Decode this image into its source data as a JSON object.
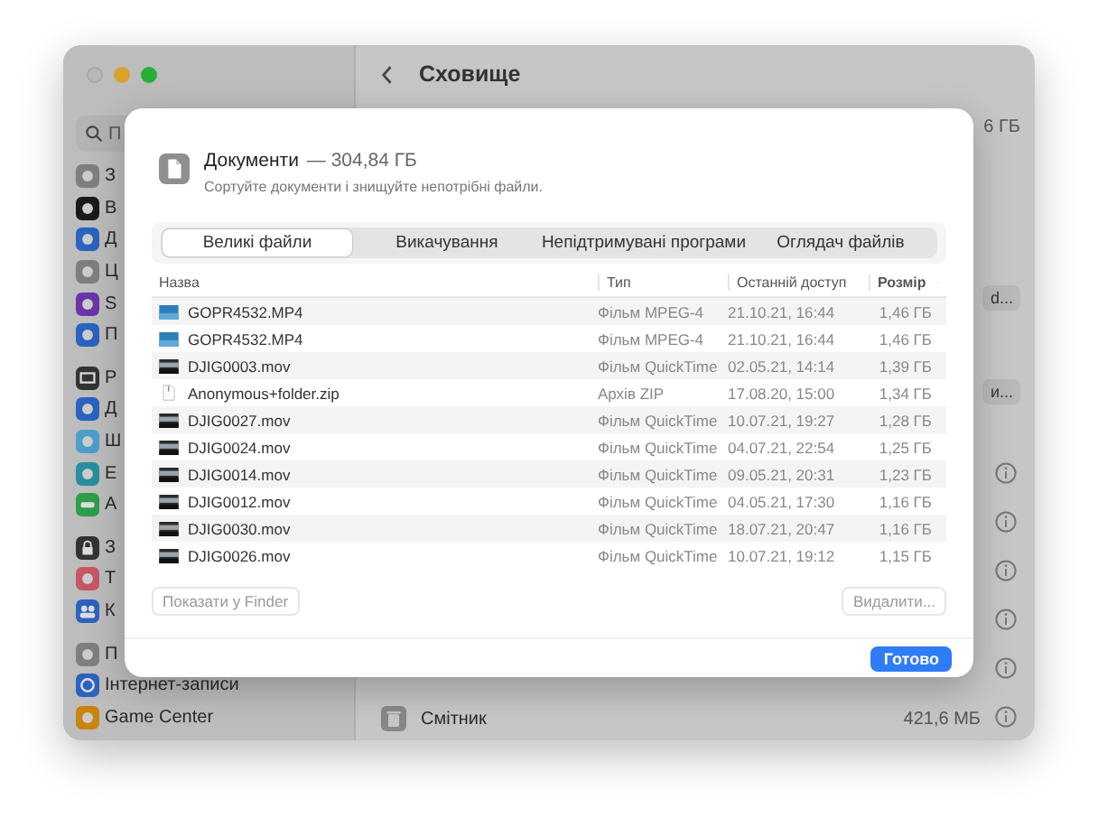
{
  "window": {
    "title": "Сховище",
    "search": {
      "placeholder": "П"
    },
    "sidebar": {
      "groups": [
        [
          {
            "label": "З"
          },
          {
            "label": "В"
          },
          {
            "label": "Д"
          },
          {
            "label": "Ц"
          },
          {
            "label": "S"
          },
          {
            "label": "П"
          }
        ],
        [
          {
            "label": "Р"
          },
          {
            "label": "Д"
          },
          {
            "label": "Ш"
          },
          {
            "label": "Е"
          },
          {
            "label": "А"
          }
        ],
        [
          {
            "label": "З"
          },
          {
            "label": "Т"
          },
          {
            "label": "К"
          }
        ],
        [
          {
            "label": "П"
          },
          {
            "label": "Інтернет-записи"
          },
          {
            "label": "Game Center"
          }
        ]
      ]
    },
    "total_fragment": "6 ГБ",
    "button_fragments": [
      "d...",
      "и..."
    ],
    "trash": {
      "label": "Смітник",
      "size": "421,6 МБ"
    }
  },
  "dialog": {
    "title": "Документи",
    "size": "— 304,84 ГБ",
    "subtitle": "Сортуйте документи і знищуйте непотрібні файли.",
    "tabs": [
      {
        "label": "Великі файли",
        "selected": true
      },
      {
        "label": "Викачування",
        "selected": false
      },
      {
        "label": "Непідтримувані програми",
        "selected": false
      },
      {
        "label": "Оглядач файлів",
        "selected": false
      }
    ],
    "table": {
      "columns": [
        {
          "label": "Назва",
          "sorted": false
        },
        {
          "label": "Тип",
          "sorted": false
        },
        {
          "label": "Останній доступ",
          "sorted": false
        },
        {
          "label": "Розмір",
          "sorted": true
        }
      ],
      "rows": [
        {
          "kind": "video",
          "name": "GOPR4532.MP4",
          "type": "Фільм MPEG-4",
          "accessed": "21.10.21, 16:44",
          "size": "1,46 ГБ"
        },
        {
          "kind": "video",
          "name": "GOPR4532.MP4",
          "type": "Фільм MPEG-4",
          "accessed": "21.10.21, 16:44",
          "size": "1,46 ГБ"
        },
        {
          "kind": "movie",
          "name": "DJIG0003.mov",
          "type": "Фільм QuickTime",
          "accessed": "02.05.21, 14:14",
          "size": "1,39 ГБ"
        },
        {
          "kind": "archive",
          "name": "Anonymous+folder.zip",
          "type": "Архів ZIP",
          "accessed": "17.08.20, 15:00",
          "size": "1,34 ГБ"
        },
        {
          "kind": "movie",
          "name": "DJIG0027.mov",
          "type": "Фільм QuickTime",
          "accessed": "10.07.21, 19:27",
          "size": "1,28 ГБ"
        },
        {
          "kind": "movie",
          "name": "DJIG0024.mov",
          "type": "Фільм QuickTime",
          "accessed": "04.07.21, 22:54",
          "size": "1,25 ГБ"
        },
        {
          "kind": "movie",
          "name": "DJIG0014.mov",
          "type": "Фільм QuickTime",
          "accessed": "09.05.21, 20:31",
          "size": "1,23 ГБ"
        },
        {
          "kind": "movie",
          "name": "DJIG0012.mov",
          "type": "Фільм QuickTime",
          "accessed": "04.05.21, 17:30",
          "size": "1,16 ГБ"
        },
        {
          "kind": "movie",
          "name": "DJIG0030.mov",
          "type": "Фільм QuickTime",
          "accessed": "18.07.21, 20:47",
          "size": "1,16 ГБ"
        },
        {
          "kind": "movie",
          "name": "DJIG0026.mov",
          "type": "Фільм QuickTime",
          "accessed": "10.07.21, 19:12",
          "size": "1,15 ГБ"
        }
      ]
    },
    "actions": [
      {
        "label": "Показати у Finder",
        "disabled": true
      },
      {
        "label": "Видалити...",
        "disabled": true
      }
    ],
    "done": {
      "label": "Готово"
    }
  }
}
